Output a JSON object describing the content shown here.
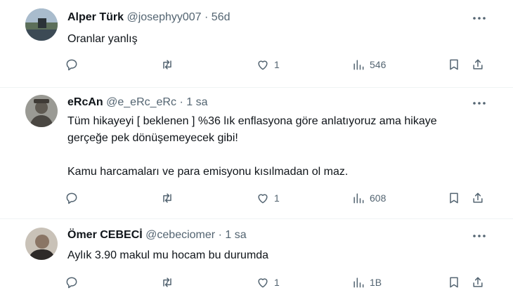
{
  "tweets": [
    {
      "display_name": "Alper Türk",
      "handle": "@josephyy007",
      "separator": "·",
      "time": "56d",
      "text": "Oranlar yanlış",
      "likes": "1",
      "views": "546"
    },
    {
      "display_name": "eRcAn",
      "handle": "@e_eRc_eRc",
      "separator": "·",
      "time": "1 sa",
      "text": "Tüm hikayeyi [ beklenen ] %36 lık enflasyona göre anlatıyoruz ama hikaye\ngerçeğe pek dönüşemeyecek gibi!\n\nKamu harcamaları ve para emisyonu kısılmadan ol maz.",
      "likes": "1",
      "views": "608"
    },
    {
      "display_name": "Ömer CEBECİ",
      "handle": "@cebeciomer",
      "separator": "·",
      "time": "1 sa",
      "text": "Aylık 3.90 makul mu hocam bu durumda",
      "likes": "1",
      "views": "1B"
    }
  ],
  "icons": [
    "more-icon",
    "reply-icon",
    "retweet-icon",
    "like-icon",
    "views-icon",
    "bookmark-icon",
    "share-icon"
  ],
  "colors": {
    "text": "#0f1419",
    "secondary": "#536471",
    "divider": "#eff3f4"
  }
}
